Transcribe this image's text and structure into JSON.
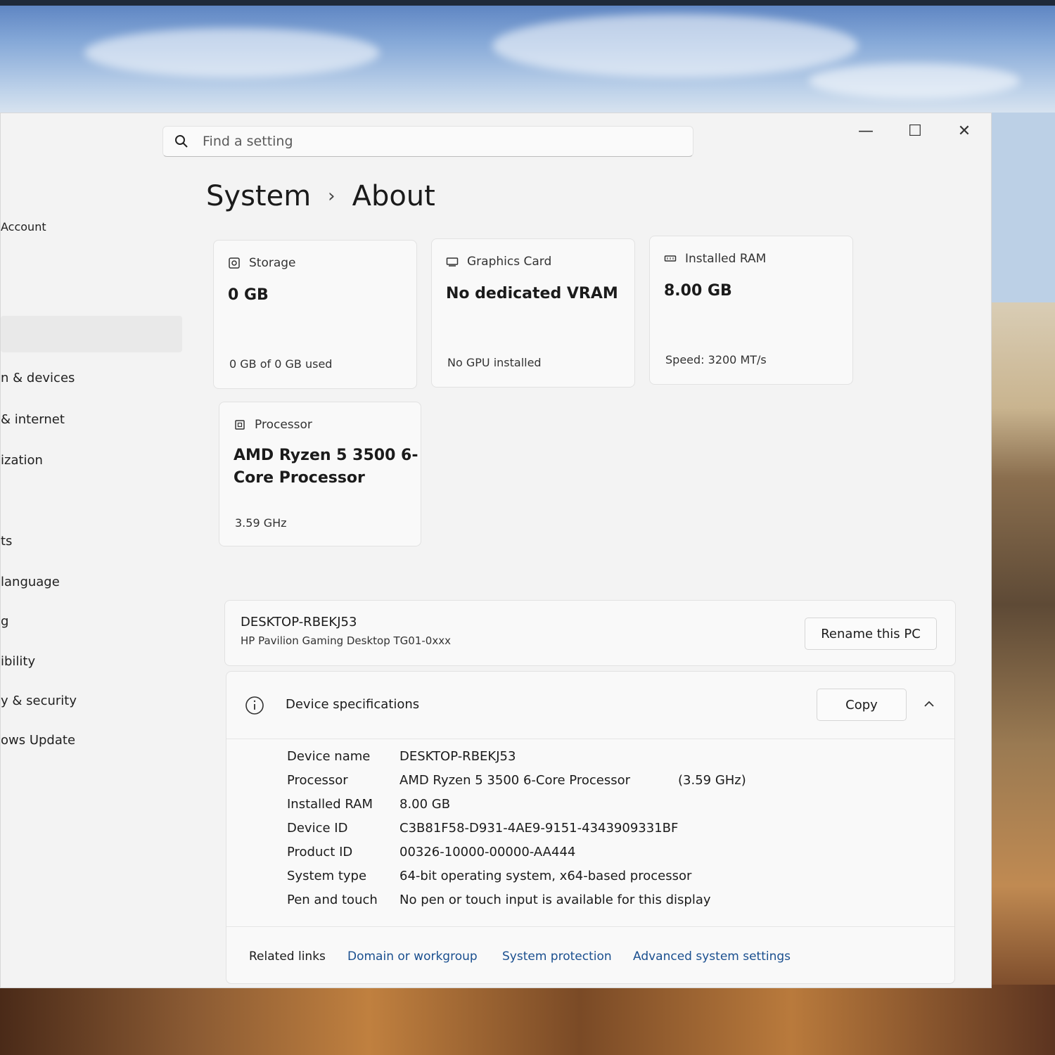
{
  "window": {
    "controls": {
      "minimize": "—",
      "maximize": "☐",
      "close": "✕"
    }
  },
  "search": {
    "placeholder": "Find a setting"
  },
  "sidebar": {
    "items": [
      {
        "label": "Account"
      },
      {
        "label": "n & devices"
      },
      {
        "label": "& internet"
      },
      {
        "label": "ization"
      },
      {
        "label": "ts"
      },
      {
        "label": "language"
      },
      {
        "label": "g"
      },
      {
        "label": "ibility"
      },
      {
        "label": "y & security"
      },
      {
        "label": "ows Update"
      }
    ]
  },
  "breadcrumb": {
    "parent": "System",
    "separator": "›",
    "current": "About"
  },
  "cards": {
    "storage": {
      "title": "Storage",
      "value": "0 GB",
      "sub": "0 GB of 0 GB used"
    },
    "graphics": {
      "title": "Graphics Card",
      "value": "No dedicated VRAM",
      "sub": "No GPU installed"
    },
    "ram": {
      "title": "Installed RAM",
      "value": "8.00 GB",
      "sub": "Speed: 3200 MT/s"
    },
    "processor": {
      "title": "Processor",
      "value_line1": "AMD Ryzen 5 3500 6-",
      "value_line2": "Core Processor",
      "sub": "3.59 GHz"
    }
  },
  "pc": {
    "name": "DESKTOP-RBEKJ53",
    "model": "HP Pavilion Gaming Desktop TG01-0xxx",
    "rename_label": "Rename this PC"
  },
  "specs": {
    "title": "Device specifications",
    "copy_label": "Copy",
    "rows": [
      {
        "label": "Device name",
        "value": "DESKTOP-RBEKJ53",
        "extra": ""
      },
      {
        "label": "Processor",
        "value": "AMD Ryzen 5 3500 6-Core Processor",
        "extra": "(3.59 GHz)"
      },
      {
        "label": "Installed RAM",
        "value": "8.00 GB",
        "extra": ""
      },
      {
        "label": "Device ID",
        "value": "C3B81F58-D931-4AE9-9151-4343909331BF",
        "extra": ""
      },
      {
        "label": "Product ID",
        "value": "00326-10000-00000-AA444",
        "extra": ""
      },
      {
        "label": "System type",
        "value": "64-bit operating system, x64-based processor",
        "extra": ""
      },
      {
        "label": "Pen and touch",
        "value": "No pen or touch input is available for this display",
        "extra": ""
      }
    ]
  },
  "related": {
    "label": "Related links",
    "links": [
      "Domain or workgroup",
      "System protection",
      "Advanced system settings"
    ]
  },
  "colors": {
    "link": "#1a4f8f",
    "window_bg": "#f3f3f3",
    "card_bg": "#f9f9f9"
  }
}
